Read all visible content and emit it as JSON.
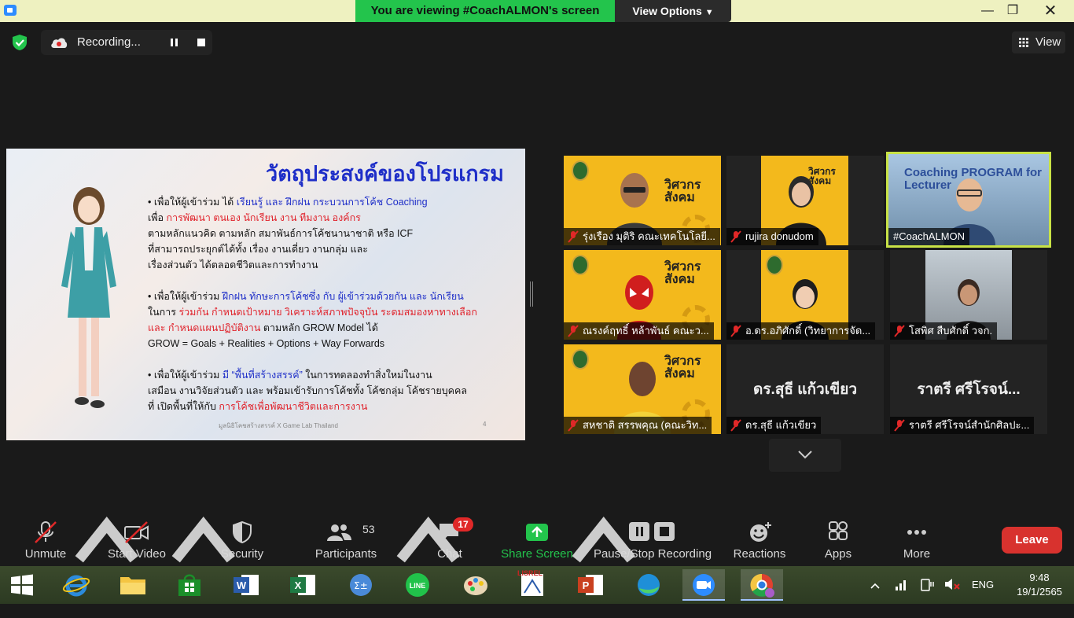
{
  "titlebar": {
    "viewing_text": "You are viewing #CoachALMON's screen",
    "view_options": "View Options"
  },
  "recording": {
    "label": "Recording..."
  },
  "view_button": {
    "label": "View"
  },
  "slide": {
    "title": "วัตถุประสงค์ของโปรแกรม",
    "para1": {
      "l1a": "• เพื่อให้ผู้เข้าร่วม ได้ ",
      "l1b": "เรียนรู้ และ ฝึกฝน กระบวนการโค้ช Coaching",
      "l2a": "เพื่อ ",
      "l2b": "การพัฒนา ตนเอง นักเรียน งาน ทีมงาน องค์กร",
      "l3": "ตามหลักแนวคิด ตามหลัก สมาพันธ์การโค้ชนานาชาติ หรือ ICF",
      "l4": "ที่สามารถประยุกต์ได้ทั้ง เรื่อง งานเดี่ยว งานกลุ่ม และ",
      "l5": "เรื่องส่วนตัว ได้ตลอดชีวิตและการทำงาน"
    },
    "para2": {
      "l1a": "• เพื่อให้ผู้เข้าร่วม ",
      "l1b": "ฝึกฝน ทักษะการโค้ชซึ่ง กับ ผู้เข้าร่วมด้วยกัน และ นักเรียน",
      "l2a": "ในการ ",
      "l2b": "ร่วมกัน กำหนดเป้าหมาย วิเคราะห์สภาพปัจจุบัน ระดมสมองหาทางเลือก",
      "l3a": "และ กำหนดแผนปฏิบัติงาน",
      "l3b": " ตามหลัก GROW Model ได้",
      "l4": "GROW = Goals + Realities + Options + Way Forwards"
    },
    "para3": {
      "l1a": "• เพื่อให้ผู้เข้าร่วม ",
      "l1b": "มี “พื้นที่สร้างสรรค์”",
      "l1c": " ในการทดลองทำสิ่งใหม่ในงาน",
      "l2": "เสมือน งานวิจัยส่วนตัว และ พร้อมเข้ารับการโค้ชทั้ง โค้ชกลุ่ม โค้ชรายบุคคล",
      "l3a": "ที่ เปิดพื้นที่ให้กับ ",
      "l3b": "การโค้ชเพื่อพัฒนาชีวิตและการงาน"
    },
    "footer": "มูลนิธิโคชสร้างสรรค์ X Game Lab Thailand",
    "page": "4"
  },
  "participants_tiles": [
    {
      "name": "รุ่งเรือง มุติริ คณะเทคโนโลยี...",
      "brand": "วิศวกร สังคม"
    },
    {
      "name": "rujira donudom",
      "brand": "วิศวกร สังคม"
    },
    {
      "name": "#CoachALMON",
      "overlay": "Coaching PROGRAM for Lecturer"
    },
    {
      "name": "ณรงค์ฤทธิ์ หล้าพันธ์ คณะว...",
      "brand": "วิศวกร สังคม"
    },
    {
      "name": "อ.ดร.อภิศักดิ์ (วิทยาการจัด...",
      "brand": "วิศวกร สังคม"
    },
    {
      "name": "โสพิศ สืบศักดิ์ วจก."
    },
    {
      "name": "สหชาติ สรรพคุณ (คณะวิท...",
      "brand": "วิศวกร สังคม"
    },
    {
      "name": "ดร.สุธี แก้วเขียว",
      "big": "ดร.สุธี แก้วเขียว"
    },
    {
      "name": "ราตรี ศรีโรจน์สำนักศิลปะ...",
      "big": "ราตรี ศรีโรจน์..."
    }
  ],
  "toolbar": {
    "unmute": "Unmute",
    "start_video": "Start Video",
    "security": "Security",
    "participants": "Participants",
    "participants_count": "53",
    "chat": "Chat",
    "chat_badge": "17",
    "share_screen": "Share Screen",
    "pause_stop": "Pause/Stop Recording",
    "reactions": "Reactions",
    "apps": "Apps",
    "more": "More",
    "leave": "Leave"
  },
  "taskbar": {
    "lang": "ENG",
    "time": "9:48",
    "date": "19/1/2565",
    "lisrel_label": "LISREL"
  },
  "colors": {
    "zoom_green": "#23c44c",
    "leave_red": "#d8322e",
    "slide_title_blue": "#1e2ec8",
    "slide_red": "#e0222b",
    "tile_yellow": "#f3b91c",
    "active_speaker": "#c8e246"
  }
}
